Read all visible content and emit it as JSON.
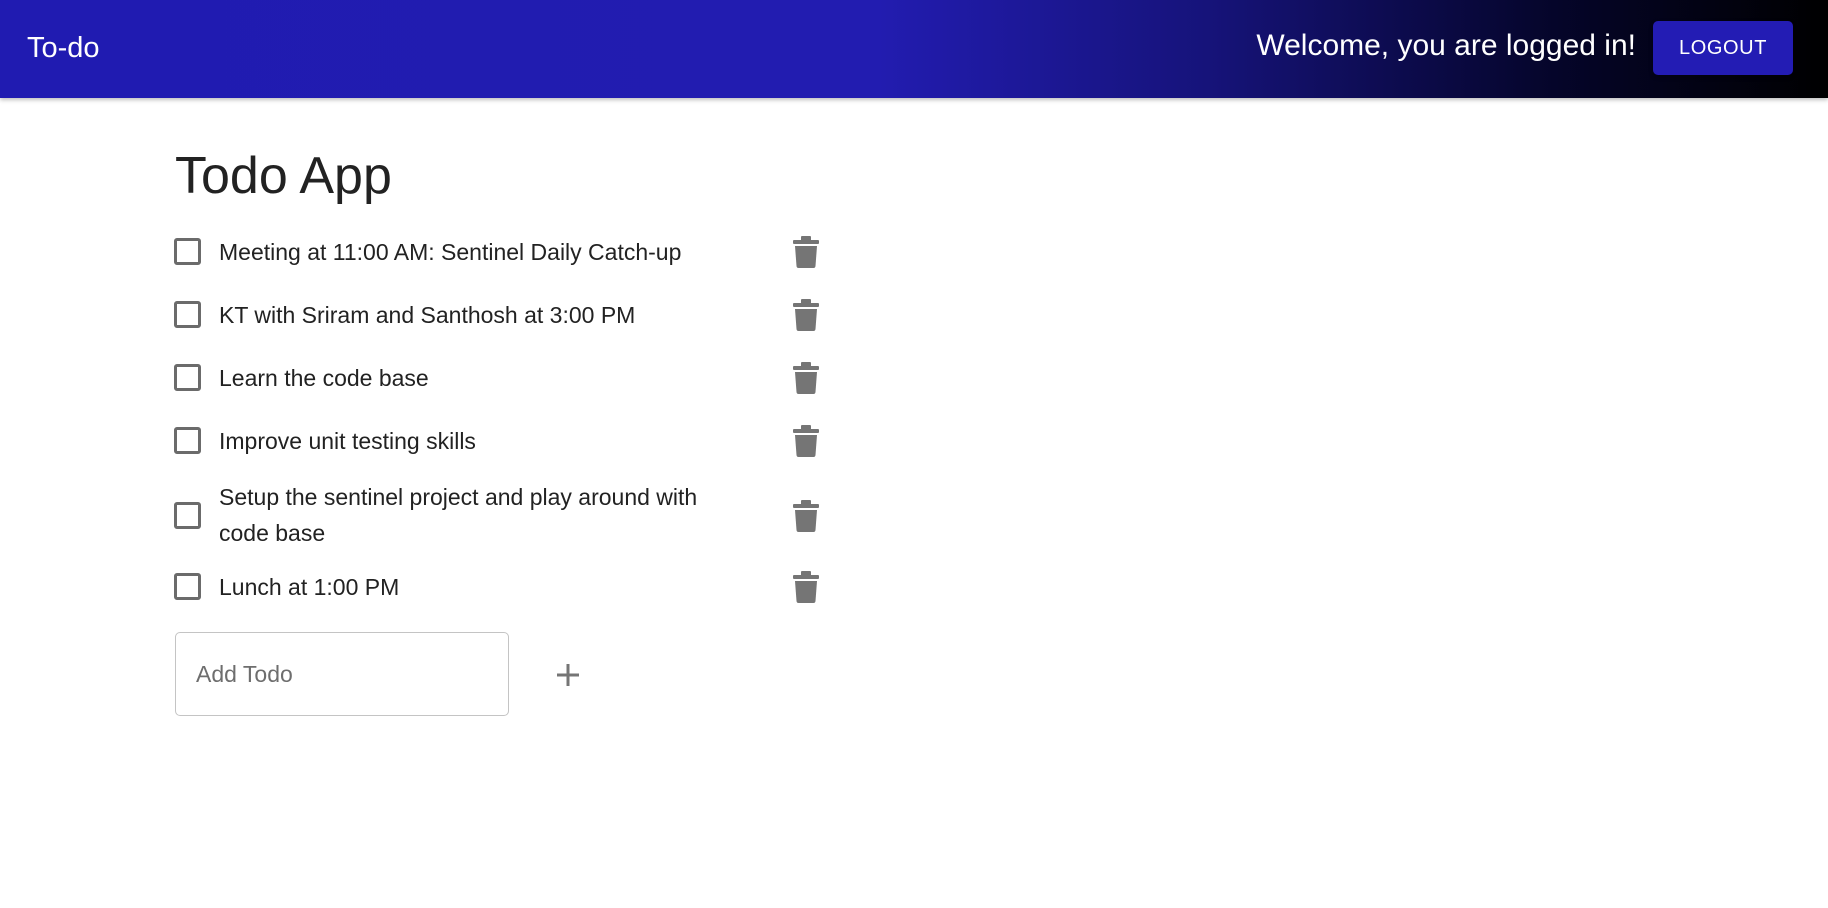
{
  "appbar": {
    "brand": "To-do",
    "welcome": "Welcome, you are logged in!",
    "logout_label": "LOGOUT"
  },
  "main": {
    "title": "Todo App",
    "todos": [
      {
        "text": "Meeting at 11:00 AM: Sentinel Daily Catch-up",
        "checked": false
      },
      {
        "text": "KT with Sriram and Santhosh at 3:00 PM",
        "checked": false
      },
      {
        "text": "Learn the code base",
        "checked": false
      },
      {
        "text": "Improve unit testing skills",
        "checked": false
      },
      {
        "text": "Setup the sentinel project and play around with code base",
        "checked": false
      },
      {
        "text": "Lunch at 1:00 PM",
        "checked": false
      }
    ],
    "add": {
      "placeholder": "Add Todo",
      "value": ""
    }
  },
  "icons": {
    "delete": "trash-icon",
    "add": "plus-icon"
  },
  "colors": {
    "appbar_start": "#201bb1",
    "appbar_end": "#000000",
    "logout_button": "#231cb4",
    "icon_gray": "#757575"
  }
}
